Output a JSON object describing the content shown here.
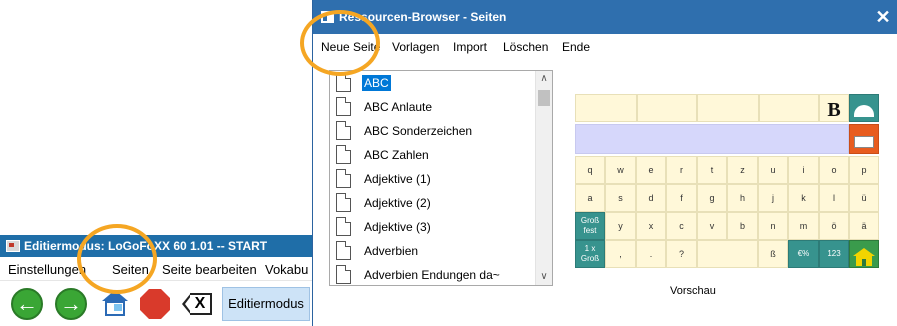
{
  "editor": {
    "title": "Editiermodus:  LoGoFoXX 60 1.01 -- START",
    "menu": [
      {
        "label": "Einstellungen"
      },
      {
        "label": "Seiten"
      },
      {
        "label": "Seite bearbeiten"
      },
      {
        "label": "Vokabu"
      }
    ],
    "toolbar": {
      "back_icon": "arrow-left-icon",
      "forward_icon": "arrow-right-icon",
      "home_icon": "house-icon",
      "stop_icon": "stop-icon",
      "delete_icon": "delete-key-icon",
      "mode_label": "Editiermodus"
    }
  },
  "browser": {
    "title": "Ressourcen-Browser - Seiten",
    "close_symbol": "✕",
    "menu": [
      {
        "label": "Neue Seite"
      },
      {
        "label": "Vorlagen"
      },
      {
        "label": "Import"
      },
      {
        "label": "Löschen"
      },
      {
        "label": "Ende"
      }
    ],
    "pages": [
      {
        "label": "ABC",
        "selected": true
      },
      {
        "label": "ABC Anlaute"
      },
      {
        "label": "ABC Sonderzeichen"
      },
      {
        "label": "ABC Zahlen"
      },
      {
        "label": "Adjektive (1)"
      },
      {
        "label": "Adjektive (2)"
      },
      {
        "label": "Adjektive (3)"
      },
      {
        "label": "Adverbien"
      },
      {
        "label": "Adverbien Endungen da~"
      }
    ],
    "scroll_up": "∧",
    "scroll_down": "∨",
    "preview_caption": "Vorschau",
    "preview": {
      "row_keys_1": [
        "q",
        "w",
        "e",
        "r",
        "t",
        "z",
        "u",
        "i",
        "o",
        "p"
      ],
      "row_keys_2": [
        "a",
        "s",
        "d",
        "f",
        "g",
        "h",
        "j",
        "k",
        "l",
        "ü"
      ],
      "row_keys_3": [
        "y",
        "x",
        "c",
        "v",
        "b",
        "n",
        "m",
        "ö",
        "ä"
      ],
      "gross_fest": "Groß fest",
      "one_gross": "1 x Groß",
      "comma": ",",
      "period": ".",
      "question": "?",
      "eszett": "ß",
      "euro": "€%",
      "numbers": "123",
      "big_b": "B"
    }
  }
}
